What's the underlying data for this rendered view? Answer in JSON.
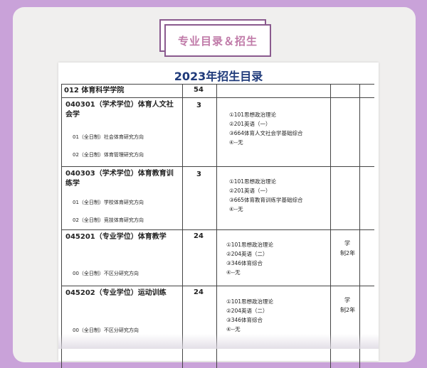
{
  "banner": {
    "title": "专业目录＆招生"
  },
  "document": {
    "title": "2023年招生目录",
    "college": {
      "name": "012 体育科学学院",
      "count": "54"
    },
    "majors": [
      {
        "name_line1": "040301（学术学位）体育人文社",
        "name_line2": "会学",
        "count": "3",
        "directions": [
          "01（全日制）社会体育研究方向",
          "02（全日制）体育管理研究方向"
        ],
        "subjects": [
          "①101思想政治理论",
          "②201英语（一）",
          "③664体育人文社会学基础综合",
          "④--无"
        ],
        "note_line1": "",
        "note_line2": ""
      },
      {
        "name_line1": "040303（学术学位）体育教育训",
        "name_line2": "练学",
        "count": "3",
        "directions": [
          "01（全日制）学校体育研究方向",
          "02（全日制）竞技体育研究方向"
        ],
        "subjects": [
          "①101思想政治理论",
          "②201英语（一）",
          "③665体育教育训练学基础综合",
          "④--无"
        ],
        "note_line1": "",
        "note_line2": ""
      },
      {
        "name_line1": "045201（专业学位）体育教学",
        "name_line2": "",
        "count": "24",
        "directions": [
          "00（全日制）不区分研究方向"
        ],
        "subjects": [
          "①101思想政治理论",
          "②204英语（二）",
          "③346体育综合",
          "④--无"
        ],
        "note_line1": "学",
        "note_line2": "制2年"
      },
      {
        "name_line1": "045202（专业学位）运动训练",
        "name_line2": "",
        "count": "24",
        "directions": [
          "00（全日制）不区分研究方向"
        ],
        "subjects": [
          "①101思想政治理论",
          "②204英语（二）",
          "③346体育综合",
          "④--无"
        ],
        "note_line1": "学",
        "note_line2": "制2年"
      }
    ]
  }
}
